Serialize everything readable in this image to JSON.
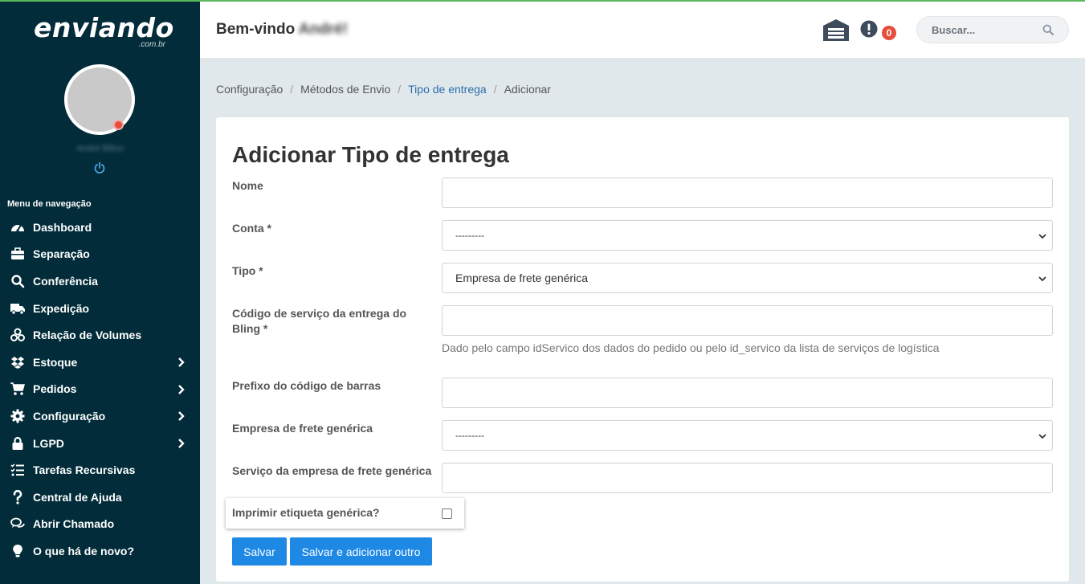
{
  "brand": {
    "name": "enviando",
    "suffix": ".com.br"
  },
  "user": {
    "name": "André Bilico"
  },
  "sidebar": {
    "heading": "Menu de navegação",
    "items": [
      {
        "label": "Dashboard",
        "icon": "gauge-icon",
        "has_submenu": false
      },
      {
        "label": "Separação",
        "icon": "briefcase-icon",
        "has_submenu": false
      },
      {
        "label": "Conferência",
        "icon": "search-icon",
        "has_submenu": false
      },
      {
        "label": "Expedição",
        "icon": "truck-icon",
        "has_submenu": false
      },
      {
        "label": "Relação de Volumes",
        "icon": "boxes-icon",
        "has_submenu": false
      },
      {
        "label": "Estoque",
        "icon": "dropbox-icon",
        "has_submenu": true
      },
      {
        "label": "Pedidos",
        "icon": "cart-icon",
        "has_submenu": true
      },
      {
        "label": "Configuração",
        "icon": "gear-icon",
        "has_submenu": true
      },
      {
        "label": "LGPD",
        "icon": "lock-icon",
        "has_submenu": true
      },
      {
        "label": "Tarefas Recursivas",
        "icon": "tasks-icon",
        "has_submenu": false
      },
      {
        "label": "Central de Ajuda",
        "icon": "question-icon",
        "has_submenu": false
      },
      {
        "label": "Abrir Chamado",
        "icon": "comments-icon",
        "has_submenu": false
      },
      {
        "label": "O que há de novo?",
        "icon": "lightbulb-icon",
        "has_submenu": false
      }
    ]
  },
  "header": {
    "welcome_prefix": "Bem-vindo",
    "welcome_name": "André!",
    "notification_count": "0",
    "search_placeholder": "Buscar..."
  },
  "breadcrumb": [
    "Configuração",
    "Métodos de Envio",
    "Tipo de entrega",
    "Adicionar"
  ],
  "form": {
    "title": "Adicionar Tipo de entrega",
    "fields": {
      "nome": {
        "label": "Nome",
        "value": ""
      },
      "conta": {
        "label": "Conta *",
        "value": "---------"
      },
      "tipo": {
        "label": "Tipo *",
        "value": "Empresa de frete genérica"
      },
      "codigo": {
        "label": "Código de serviço da entrega do Bling *",
        "value": "",
        "help": "Dado pelo campo idServico dos dados do pedido ou pelo id_servico da lista de serviços de logística"
      },
      "prefixo": {
        "label": "Prefixo do código de barras",
        "value": ""
      },
      "empresa": {
        "label": "Empresa de frete genérica",
        "value": "---------"
      },
      "servico": {
        "label": "Serviço da empresa de frete genérica",
        "value": ""
      },
      "imprimir": {
        "label": "Imprimir etiqueta genérica?",
        "checked": false
      }
    },
    "buttons": {
      "save": "Salvar",
      "save_add": "Salvar e adicionar outro"
    }
  },
  "colors": {
    "sidebar": "#022c3a",
    "accent": "#1e88e5",
    "brand_green": "#5cb85c",
    "badge": "#e74c3c"
  }
}
